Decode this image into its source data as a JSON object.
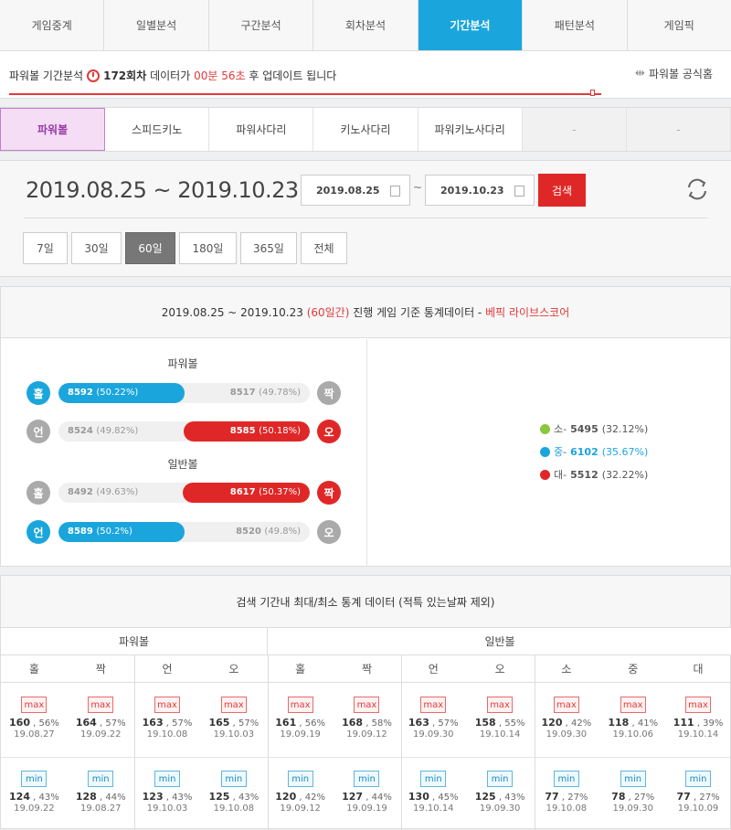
{
  "topnav": {
    "tabs": [
      "게임중계",
      "일별분석",
      "구간분석",
      "회차분석",
      "기간분석",
      "패턴분석",
      "게임픽"
    ],
    "active": "기간분석"
  },
  "infobar": {
    "prefix": "파워볼 기간분석",
    "round": "172회차",
    "mid": "데이터가",
    "countdown": "00분 56초",
    "suffix": "후 업데이트 됩니다",
    "progress_fraction": 0.81,
    "home_label": "파워볼 공식홈"
  },
  "gametabs": {
    "tabs": [
      "파워볼",
      "스피드키노",
      "파워사다리",
      "키노사다리",
      "파워키노사다리",
      "-",
      "-"
    ],
    "active": "파워볼"
  },
  "datepanel": {
    "range_text": "2019.08.25 ~ 2019.10.23",
    "start_date": "2019.08.25",
    "tilde": "~",
    "end_date": "2019.10.23",
    "search_label": "검색",
    "periods": [
      "7일",
      "30일",
      "60일",
      "180일",
      "365일",
      "전체"
    ],
    "active_period": "60일"
  },
  "stats": {
    "head_prefix": "2019.08.25 ~ 2019.10.23",
    "head_days": "(60일간)",
    "head_mid": "진행 게임 기준 통계데이터 -",
    "head_source": "베픽 라이브스코어",
    "powerball_title": "파워볼",
    "normal_title": "일반볼",
    "rows": [
      {
        "left_char": "홀",
        "left_val": "8592",
        "left_pct": "(50.22%)",
        "right_val": "8517",
        "right_pct": "(49.78%)",
        "right_char": "짝",
        "winner": "left",
        "fill_color": "blue",
        "fill_pct": 50.22
      },
      {
        "left_char": "언",
        "left_val": "8524",
        "left_pct": "(49.82%)",
        "right_val": "8585",
        "right_pct": "(50.18%)",
        "right_char": "오",
        "winner": "right",
        "fill_color": "red",
        "fill_pct": 50.18
      },
      {
        "left_char": "홀",
        "left_val": "8492",
        "left_pct": "(49.63%)",
        "right_val": "8617",
        "right_pct": "(50.37%)",
        "right_char": "짝",
        "winner": "right",
        "fill_color": "red",
        "fill_pct": 50.37
      },
      {
        "left_char": "언",
        "left_val": "8589",
        "left_pct": "(50.2%)",
        "right_val": "8520",
        "right_pct": "(49.8%)",
        "right_char": "오",
        "winner": "left",
        "fill_color": "blue",
        "fill_pct": 50.2
      }
    ],
    "legend": [
      {
        "label": "소",
        "sep": "-",
        "value": "5495",
        "pct": "(32.12%)",
        "color": "#8cc63f",
        "highlight": false
      },
      {
        "label": "중",
        "sep": "-",
        "value": "6102",
        "pct": "(35.67%)",
        "color": "#1aa6dc",
        "highlight": true
      },
      {
        "label": "대",
        "sep": "-",
        "value": "5512",
        "pct": "(32.22%)",
        "color": "#e02727",
        "highlight": false
      }
    ]
  },
  "minmax": {
    "title": "검색 기간내 최대/최소 통계 데이터 (적특 있는날짜 제외)",
    "group_powerball": "파워볼",
    "group_normal": "일반볼",
    "columns": [
      "홀",
      "짝",
      "언",
      "오",
      "홀",
      "짝",
      "언",
      "오",
      "소",
      "중",
      "대"
    ],
    "max_label": "max",
    "min_label": "min",
    "max": [
      {
        "v": "160",
        "p": "56%",
        "d": "19.08.27"
      },
      {
        "v": "164",
        "p": "57%",
        "d": "19.09.22"
      },
      {
        "v": "163",
        "p": "57%",
        "d": "19.10.08"
      },
      {
        "v": "165",
        "p": "57%",
        "d": "19.10.03"
      },
      {
        "v": "161",
        "p": "56%",
        "d": "19.09.19"
      },
      {
        "v": "168",
        "p": "58%",
        "d": "19.09.12"
      },
      {
        "v": "163",
        "p": "57%",
        "d": "19.09.30"
      },
      {
        "v": "158",
        "p": "55%",
        "d": "19.10.14"
      },
      {
        "v": "120",
        "p": "42%",
        "d": "19.09.30"
      },
      {
        "v": "118",
        "p": "41%",
        "d": "19.10.06"
      },
      {
        "v": "111",
        "p": "39%",
        "d": "19.10.14"
      }
    ],
    "min": [
      {
        "v": "124",
        "p": "43%",
        "d": "19.09.22"
      },
      {
        "v": "128",
        "p": "44%",
        "d": "19.08.27"
      },
      {
        "v": "123",
        "p": "43%",
        "d": "19.10.03"
      },
      {
        "v": "125",
        "p": "43%",
        "d": "19.10.08"
      },
      {
        "v": "120",
        "p": "42%",
        "d": "19.09.12"
      },
      {
        "v": "127",
        "p": "44%",
        "d": "19.09.19"
      },
      {
        "v": "130",
        "p": "45%",
        "d": "19.10.14"
      },
      {
        "v": "125",
        "p": "43%",
        "d": "19.09.30"
      },
      {
        "v": "77",
        "p": "27%",
        "d": "19.10.08"
      },
      {
        "v": "78",
        "p": "27%",
        "d": "19.09.30"
      },
      {
        "v": "77",
        "p": "27%",
        "d": "19.10.09"
      }
    ]
  }
}
